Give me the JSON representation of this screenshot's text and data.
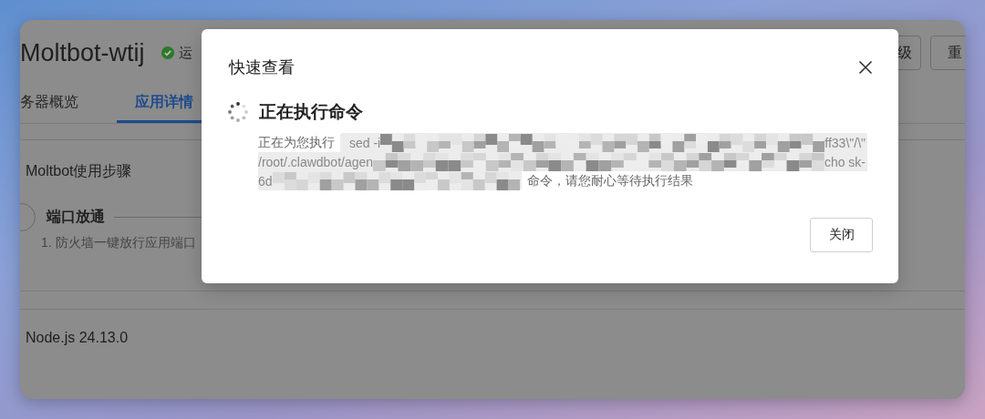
{
  "background_window": {
    "title": "Moltbot-wtij",
    "status": "运",
    "buttons": [
      "级",
      "重"
    ],
    "tabs": [
      {
        "label": "务器概览",
        "selected": false
      },
      {
        "label": "应用详情",
        "selected": true
      }
    ],
    "section_title": "Moltbot使用步骤",
    "step": {
      "title": "端口放通",
      "description": "1. 防火墙一键放行应用端口"
    },
    "version": "Node.js 24.13.0"
  },
  "dialog": {
    "title": "快速查看",
    "status_title": "正在执行命令",
    "message": {
      "prefix": "正在为您执行",
      "command_lines": [
        {
          "start": "sed -i",
          "end": "ff33\\\"/\\\""
        },
        {
          "start": "/root/.clawdbot/agen",
          "end": "cho sk-"
        },
        {
          "start": "6d"
        }
      ],
      "suffix": "命令，请您耐心等待执行结果"
    },
    "buttons": [
      "关闭"
    ]
  }
}
